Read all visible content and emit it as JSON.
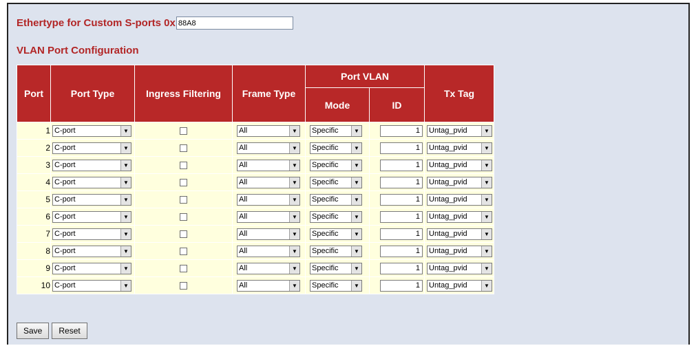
{
  "ethertype": {
    "label": "Ethertype for Custom S-ports 0x",
    "value": "88A8"
  },
  "section_title": "VLAN Port Configuration",
  "table": {
    "headers": {
      "port": "Port",
      "port_type": "Port Type",
      "ingress_filtering": "Ingress Filtering",
      "frame_type": "Frame Type",
      "port_vlan": "Port VLAN",
      "mode": "Mode",
      "id": "ID",
      "tx_tag": "Tx Tag"
    },
    "rows": [
      {
        "port": "1",
        "port_type": "C-port",
        "ingress_filtering": false,
        "frame_type": "All",
        "mode": "Specific",
        "id": "1",
        "tx_tag": "Untag_pvid"
      },
      {
        "port": "2",
        "port_type": "C-port",
        "ingress_filtering": false,
        "frame_type": "All",
        "mode": "Specific",
        "id": "1",
        "tx_tag": "Untag_pvid"
      },
      {
        "port": "3",
        "port_type": "C-port",
        "ingress_filtering": false,
        "frame_type": "All",
        "mode": "Specific",
        "id": "1",
        "tx_tag": "Untag_pvid"
      },
      {
        "port": "4",
        "port_type": "C-port",
        "ingress_filtering": false,
        "frame_type": "All",
        "mode": "Specific",
        "id": "1",
        "tx_tag": "Untag_pvid"
      },
      {
        "port": "5",
        "port_type": "C-port",
        "ingress_filtering": false,
        "frame_type": "All",
        "mode": "Specific",
        "id": "1",
        "tx_tag": "Untag_pvid"
      },
      {
        "port": "6",
        "port_type": "C-port",
        "ingress_filtering": false,
        "frame_type": "All",
        "mode": "Specific",
        "id": "1",
        "tx_tag": "Untag_pvid"
      },
      {
        "port": "7",
        "port_type": "C-port",
        "ingress_filtering": false,
        "frame_type": "All",
        "mode": "Specific",
        "id": "1",
        "tx_tag": "Untag_pvid"
      },
      {
        "port": "8",
        "port_type": "C-port",
        "ingress_filtering": false,
        "frame_type": "All",
        "mode": "Specific",
        "id": "1",
        "tx_tag": "Untag_pvid"
      },
      {
        "port": "9",
        "port_type": "C-port",
        "ingress_filtering": false,
        "frame_type": "All",
        "mode": "Specific",
        "id": "1",
        "tx_tag": "Untag_pvid"
      },
      {
        "port": "10",
        "port_type": "C-port",
        "ingress_filtering": false,
        "frame_type": "All",
        "mode": "Specific",
        "id": "1",
        "tx_tag": "Untag_pvid"
      }
    ]
  },
  "buttons": {
    "save": "Save",
    "reset": "Reset"
  },
  "colors": {
    "accent_red": "#b82828",
    "title_red": "#b22626",
    "page_background": "#dde3ee",
    "row_background": "#ffffde"
  },
  "icons": {
    "dropdown": "chevron-down-icon",
    "checkbox": "checkbox-unchecked"
  }
}
